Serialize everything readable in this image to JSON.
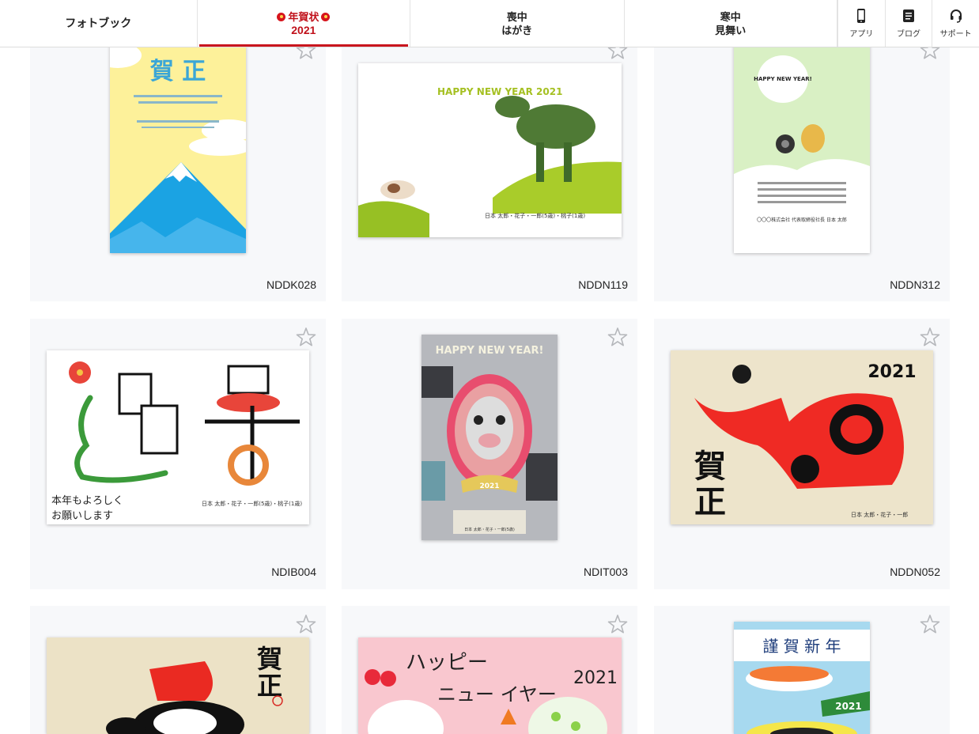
{
  "nav": {
    "tabs": [
      {
        "line1": "フォトブック",
        "line2": ""
      },
      {
        "line1": "年賀状",
        "line2": "2021"
      },
      {
        "line1": "喪中",
        "line2": "はがき"
      },
      {
        "line1": "寒中",
        "line2": "見舞い"
      }
    ],
    "utils": [
      {
        "label": "アプリ",
        "icon": "phone-icon"
      },
      {
        "label": "ブログ",
        "icon": "blog-icon"
      },
      {
        "label": "サポート",
        "icon": "headset-icon"
      }
    ],
    "accent": "#c9151e"
  },
  "cards": [
    {
      "code": "NDDK028"
    },
    {
      "code": "NDDN119"
    },
    {
      "code": "NDDN312"
    },
    {
      "code": "NDIB004"
    },
    {
      "code": "NDIT003"
    },
    {
      "code": "NDDN052"
    },
    {
      "code": ""
    },
    {
      "code": ""
    },
    {
      "code": ""
    }
  ],
  "thumbs": {
    "t1": {
      "title": "賀 正"
    },
    "t2": {
      "title": "HAPPY NEW YEAR 2021",
      "name": "日本 太郎・花子・一郎(5歳)・桃子(1歳)"
    },
    "t3": {
      "title": "HAPPY NEW YEAR!",
      "company": "〇〇〇株式会社 代表取締役社長 日本 太郎"
    },
    "t4": {
      "greeting1": "本年もよろしく",
      "greeting2": "お願いします",
      "name": "日本 太郎・花子・一郎(5歳)・桃子(1歳)"
    },
    "t5": {
      "title": "HAPPY NEW YEAR!",
      "year": "2021",
      "name": "日本 太郎・花子・一郎(5歳)"
    },
    "t6": {
      "year": "2021",
      "kanji1": "賀",
      "kanji2": "正",
      "name": "日本 太郎・花子・一郎"
    },
    "t7": {
      "kanji1": "賀",
      "kanji2": "正"
    },
    "t8": {
      "title1": "ハッピー",
      "title2": "ニュー イヤー",
      "year": "2021"
    },
    "t9": {
      "title": "謹 賀 新 年",
      "year": "2021"
    }
  }
}
